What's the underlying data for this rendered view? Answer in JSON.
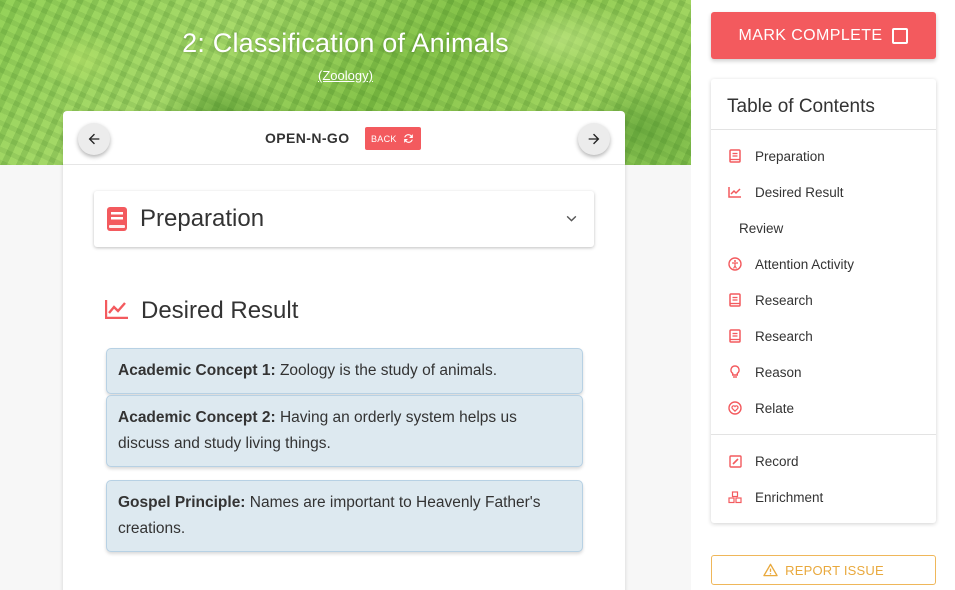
{
  "lesson": {
    "title": "2: Classification of Animals",
    "subject_link": "(Zoology)"
  },
  "card_header": {
    "mode_label": "OPEN-N-GO",
    "back_label": "BACK"
  },
  "preparation": {
    "title": "Preparation"
  },
  "desired_result": {
    "title": "Desired Result",
    "concepts": [
      {
        "label": "Academic Concept 1:",
        "text": " Zoology is the study of animals."
      },
      {
        "label": "Academic Concept 2:",
        "text": " Having an orderly system helps us discuss and study living things."
      },
      {
        "label": "Gospel Principle:",
        "text": " Names are important to Heavenly Father's creations."
      }
    ]
  },
  "sidebar": {
    "mark_complete_label": "MARK COMPLETE",
    "toc_title": "Table of Contents",
    "toc_items": [
      {
        "label": "Preparation",
        "icon": "book-icon"
      },
      {
        "label": "Desired Result",
        "icon": "trending-up-icon"
      },
      {
        "label": "Review",
        "icon": ""
      },
      {
        "label": "Attention Activity",
        "icon": "accessibility-icon"
      },
      {
        "label": "Research",
        "icon": "book-icon"
      },
      {
        "label": "Research",
        "icon": "book-icon"
      },
      {
        "label": "Reason",
        "icon": "lightbulb-icon"
      },
      {
        "label": "Relate",
        "icon": "heart-circle-icon"
      },
      {
        "label": "Record",
        "icon": "pencil-square-icon"
      },
      {
        "label": "Enrichment",
        "icon": "blocks-icon"
      }
    ],
    "report_issue_label": "REPORT ISSUE"
  },
  "colors": {
    "accent_red": "#f35a5e",
    "concept_bg": "#dde9f0",
    "report_orange": "#e9a93d"
  }
}
